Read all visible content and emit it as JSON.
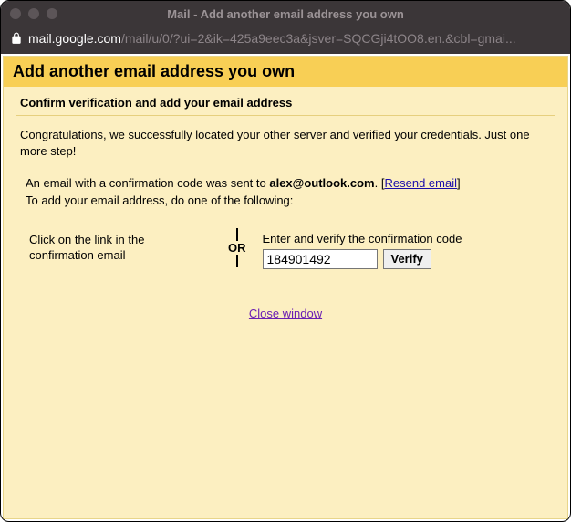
{
  "window": {
    "title": "Mail - Add another email address you own"
  },
  "address": {
    "domain": "mail.google.com",
    "path": "/mail/u/0/?ui=2&ik=425a9eec3a&jsver=SQCGji4tOO8.en.&cbl=gmai..."
  },
  "page": {
    "title": "Add another email address you own",
    "subheading": "Confirm verification and add your email address",
    "congrats": "Congratulations, we successfully located your other server and verified your credentials. Just one more step!",
    "confirm_prefix": "An email with a confirmation code was sent to ",
    "confirm_email": "alex@outlook.com",
    "confirm_suffix_dot": ". ",
    "resend_label": "Resend email",
    "instructions_line2": "To add your email address, do one of the following:",
    "left_option": "Click on the link in the confirmation email",
    "or_label": "OR",
    "right_option_label": "Enter and verify the confirmation code",
    "code_value": "184901492",
    "verify_label": "Verify",
    "close_label": "Close window"
  }
}
